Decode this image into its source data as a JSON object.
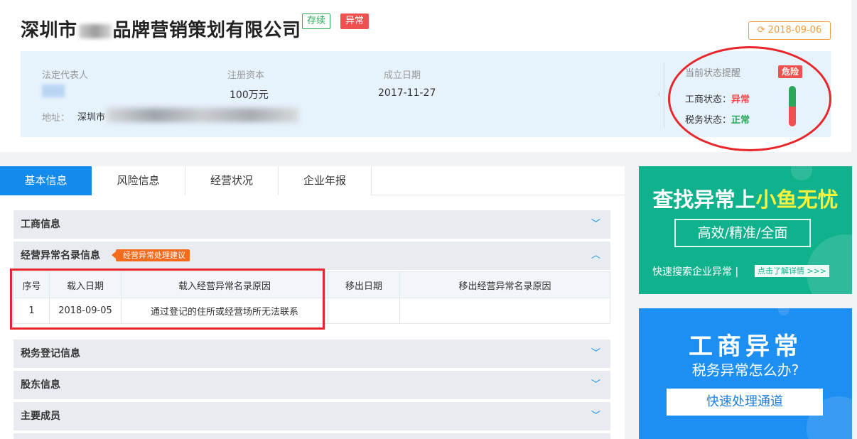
{
  "header": {
    "company_prefix": "深圳市",
    "company_suffix": "品牌营销策划有限公司",
    "tag_status": "存续",
    "tag_abnormal": "异常",
    "date_button": "2018-09-06",
    "date_icon": "refresh-icon"
  },
  "info": {
    "legal_rep_label": "法定代表人",
    "capital_label": "注册资本",
    "capital_value": "100万元",
    "founded_label": "成立日期",
    "founded_value": "2017-11-27",
    "address_label": "地址：",
    "address_value": "深圳市"
  },
  "status_panel": {
    "title": "当前状态提醒",
    "danger": "危险",
    "biz_label": "工商状态：",
    "biz_value": "异常",
    "tax_label": "税务状态：",
    "tax_value": "正常"
  },
  "tabs": [
    "基本信息",
    "风险信息",
    "经营状况",
    "企业年报"
  ],
  "sections": {
    "business_info": "工商信息",
    "abnormal_list": "经营异常名录信息",
    "abnormal_tag": "经营异常处理建议",
    "tax_reg": "税务登记信息",
    "shareholders": "股东信息",
    "members": "主要成员"
  },
  "table": {
    "headers": [
      "序号",
      "载入日期",
      "载入经营异常名录原因",
      "移出日期",
      "移出经营异常名录原因"
    ],
    "rows": [
      [
        "1",
        "2018-09-05",
        "通过登记的住所或经营场所无法联系",
        "",
        ""
      ]
    ]
  },
  "ad1": {
    "headline_a": "查找异常上",
    "headline_b": "小鱼无忧",
    "box": "高效/精准/全面",
    "sub": "快速搜索企业异常 |",
    "link": "点击了解详情 >>>"
  },
  "ad2": {
    "headline": "工商异常",
    "sub": "税务异常怎么办?",
    "button": "快速处理通道"
  },
  "colors": {
    "primary": "#128bed",
    "danger": "#f0504f",
    "success": "#2aa85a",
    "warning": "#f59c3c",
    "ad_green": "#10b28e",
    "ad_blue": "#1d8ff2"
  }
}
